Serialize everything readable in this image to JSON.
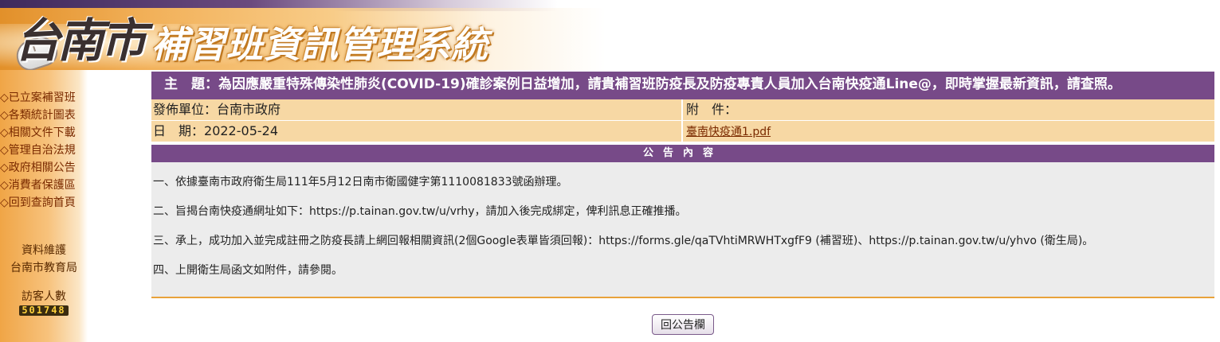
{
  "header": {
    "city_logo": "台南市",
    "system_title": "補習班資訊管理系統"
  },
  "sidebar": {
    "items": [
      {
        "label": "◇已立案補習班"
      },
      {
        "label": "◇各類統計圖表"
      },
      {
        "label": "◇相關文件下載"
      },
      {
        "label": "◇管理自治法規"
      },
      {
        "label": "◇政府相關公告"
      },
      {
        "label": "◇消費者保護區"
      },
      {
        "label": "◇回到查詢首頁"
      }
    ],
    "maintainer_label": "資料維護",
    "maintainer": "台南市教育局",
    "visitor_label": "訪客人數",
    "visitor_count": "501748"
  },
  "announcement": {
    "subject_label": "主　題：",
    "subject": "為因應嚴重特殊傳染性肺炎(COVID-19)確診案例日益增加，請貴補習班防疫長及防疫專責人員加入台南快疫通Line@，即時掌握最新資訊，請查照。",
    "publisher_label": "發佈單位：",
    "publisher": "台南市政府",
    "date_label": "日　期：",
    "date": "2022-05-24",
    "attachment_label": "附　件：",
    "attachment_file": "臺南快疫通1.pdf",
    "section_title": "公告內容",
    "paragraphs": [
      "一、依據臺南市政府衛生局111年5月12日南市衛國健字第1110081833號函辦理。",
      "二、旨揭台南快疫通網址如下：https://p.tainan.gov.tw/u/vrhy，請加入後完成綁定，俾利訊息正確推播。",
      "三、承上，成功加入並完成註冊之防疫長請上網回報相關資訊(2個Google表單皆須回報)：https://forms.gle/qaTVhtiMRWHTxgfF9 (補習班)、https://p.tainan.gov.tw/u/yhvo (衛生局)。",
      "四、上開衛生局函文如附件，請參閱。"
    ],
    "back_button": "回公告欄"
  },
  "colors": {
    "purple": "#774a88",
    "peach": "#f7d8a4",
    "orange": "#f0a546"
  }
}
